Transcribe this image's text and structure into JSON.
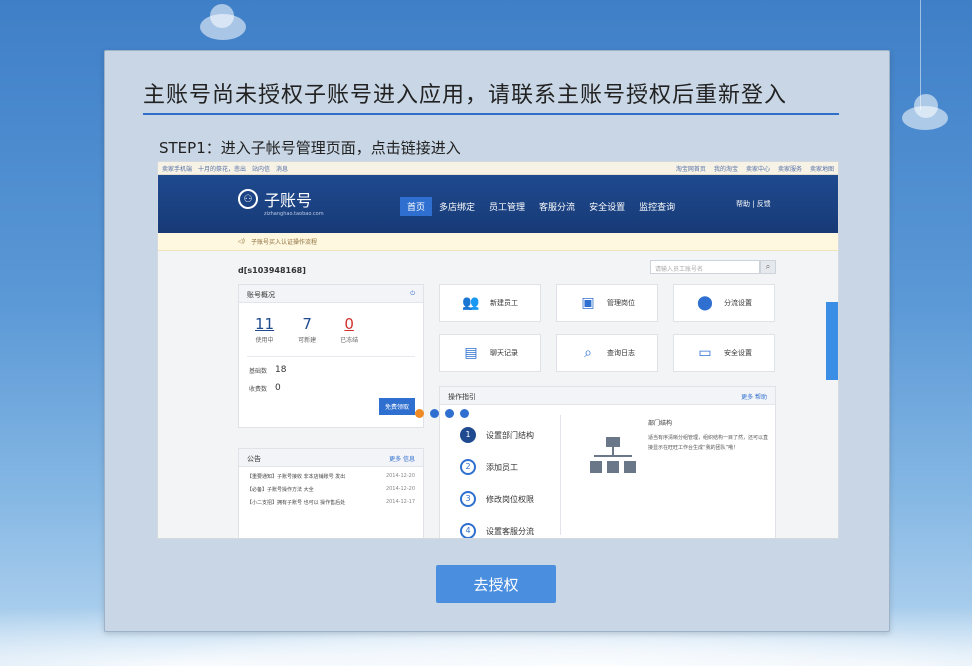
{
  "page": {
    "title": "主账号尚未授权子账号进入应用，请联系主账号授权后重新登入",
    "step_label": "STEP1：进入子帐号管理页面，点击链接进入",
    "authorize_button": "去授权",
    "colors": {
      "accent": "#2f6fc9",
      "button": "#4a8ee0",
      "panel_bg": "#c8d6e5"
    }
  },
  "screenshot": {
    "topbar_left": [
      "卖家手机端",
      "十月的祭花，悲出",
      "站内信",
      "消息"
    ],
    "topbar_right": [
      "淘宝网首页",
      "我的淘宝",
      "卖家中心",
      "卖家服务",
      "卖家地图"
    ],
    "logo_name": "子账号",
    "logo_sub": "zizhanghao.taobao.com",
    "nav": [
      "首页",
      "多店绑定",
      "员工管理",
      "客服分流",
      "安全设置",
      "监控查询"
    ],
    "nav_help": "帮助 | 反馈",
    "notice": "子账号买入认证操作流程",
    "account_id": "d[s103948168]",
    "search_placeholder": "请输入员工账号名",
    "overview": {
      "title": "账号概况",
      "stats": [
        {
          "num": "11",
          "label": "使用中"
        },
        {
          "num": "7",
          "label": "可新建"
        },
        {
          "num": "0",
          "label": "已冻结"
        }
      ],
      "basic_label": "基础数",
      "basic_value": "18",
      "paid_label": "收费数",
      "paid_value": "0",
      "upgrade": "免费领取"
    },
    "announcements": {
      "title": "公告",
      "more": "更多 信息",
      "rows": [
        {
          "text": "【重要通知】子账号接收 非本店铺账号 发出",
          "date": "2014-12-20"
        },
        {
          "text": "【必备】子账号操作方法 大全",
          "date": "2014-12-20"
        },
        {
          "text": "【小二支招】拥有子账号 也可以 操作售后处",
          "date": "2014-12-17"
        }
      ]
    },
    "tiles": [
      {
        "icon": "people-icon",
        "glyph": "👥",
        "label": "新建员工"
      },
      {
        "icon": "id-card-icon",
        "glyph": "▣",
        "label": "管理岗位"
      },
      {
        "icon": "split-icon",
        "glyph": "⬤",
        "label": "分流设置"
      },
      {
        "icon": "chat-log-icon",
        "glyph": "▤",
        "label": "聊天记录"
      },
      {
        "icon": "search-icon",
        "glyph": "⌕",
        "label": "查询日志"
      },
      {
        "icon": "password-icon",
        "glyph": "▭",
        "label": "安全设置"
      }
    ],
    "guide": {
      "title": "操作指引",
      "more": "更多 帮助",
      "steps": [
        {
          "n": "1",
          "label": "设置部门结构"
        },
        {
          "n": "2",
          "label": "添加员工"
        },
        {
          "n": "3",
          "label": "修改岗位权限"
        },
        {
          "n": "4",
          "label": "设置客服分流"
        }
      ],
      "desc_title": "部门结构",
      "desc": "适当有序清晰分组管理，组织结构一目了然，还可以直接显示在旺旺工作台生成“我的团队”哦！"
    }
  }
}
